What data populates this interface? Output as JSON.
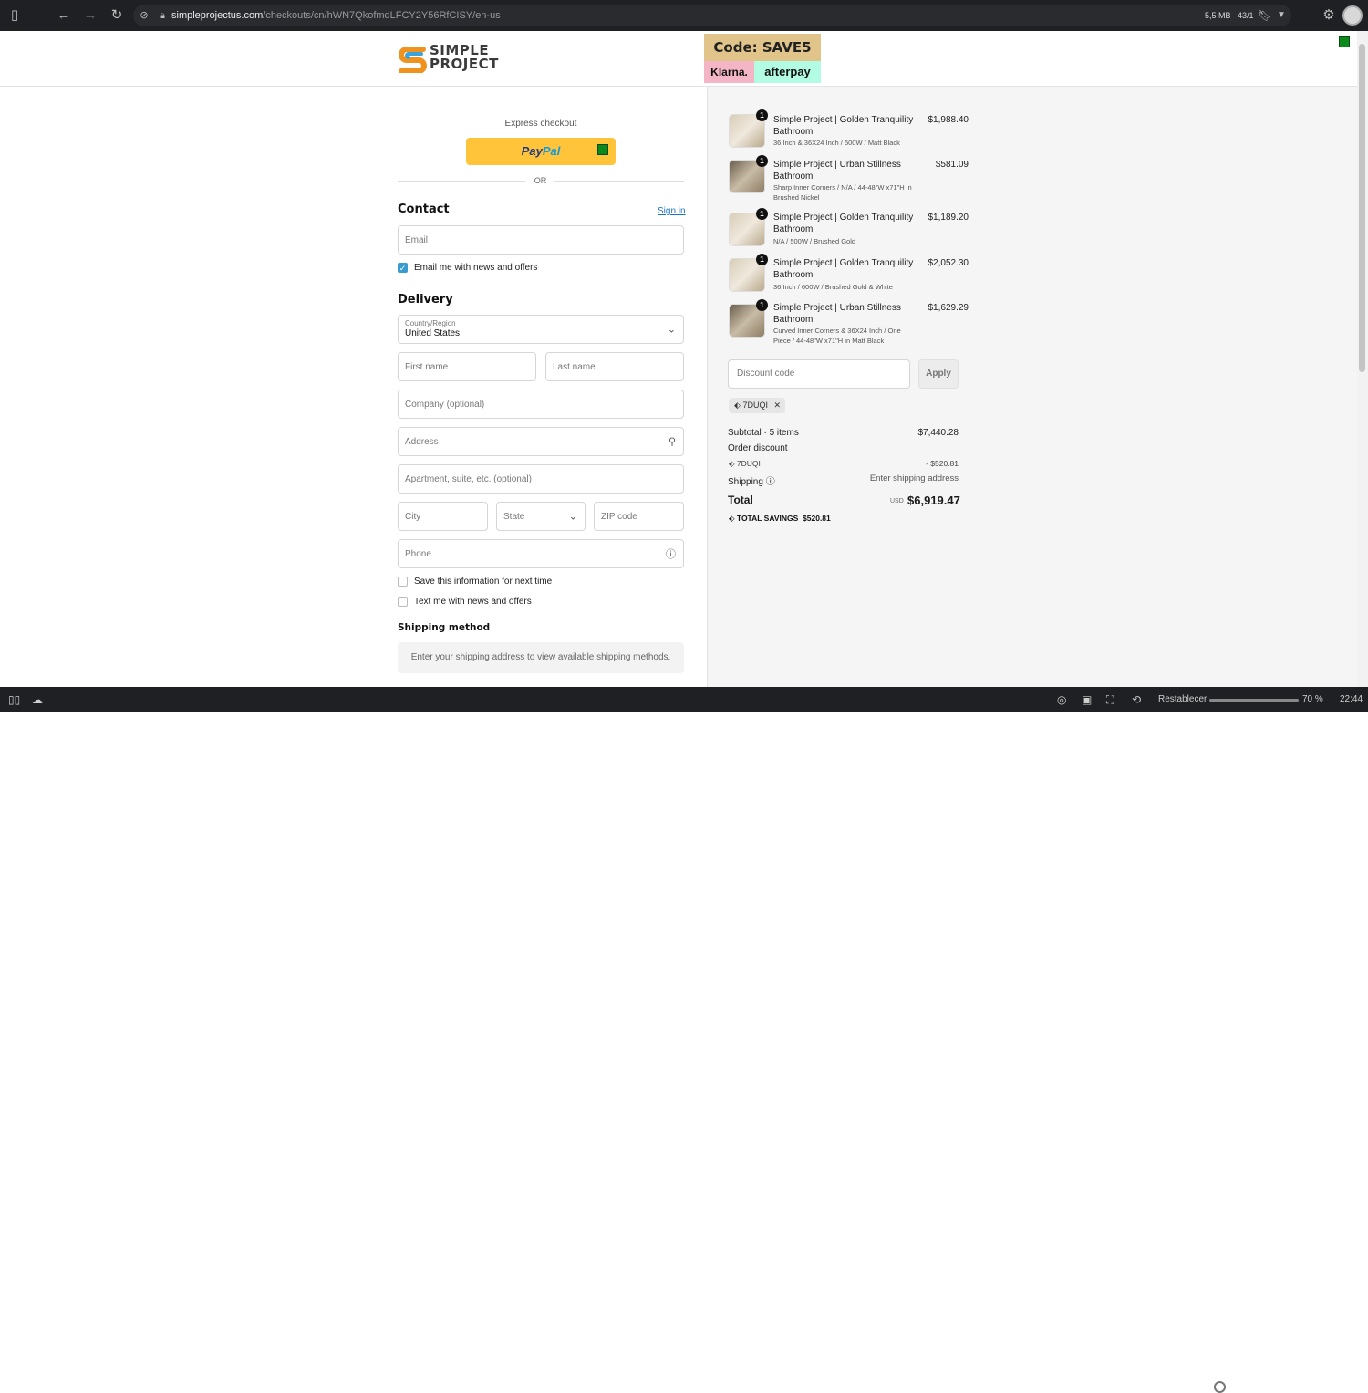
{
  "browser": {
    "url_domain": "simpleprojectus.com",
    "url_path": "/checkouts/cn/hWN7QkofmdLFCY2Y56RfCISY/en-us",
    "memory": "5,5 MB",
    "tab_count": "43/1"
  },
  "statusbar": {
    "reset_label": "Restablecer",
    "zoom": "70 %",
    "time": "22:44"
  },
  "header": {
    "logo_line1": "SIMPLE",
    "logo_line2": "PROJECT",
    "banner_code": "Code: SAVE5",
    "banner_klarna": "Klarna.",
    "banner_afterpay": "afterpay"
  },
  "checkout": {
    "express_label": "Express checkout",
    "paypal_pay": "Pay",
    "paypal_pal": "Pal",
    "or_label": "OR",
    "contact": {
      "title": "Contact",
      "sign_in": "Sign in",
      "email_placeholder": "Email",
      "news_label": "Email me with news and offers"
    },
    "delivery": {
      "title": "Delivery",
      "country_label": "Country/Region",
      "country_value": "United States",
      "first_name": "First name",
      "last_name": "Last name",
      "company": "Company (optional)",
      "address": "Address",
      "apartment": "Apartment, suite, etc. (optional)",
      "city": "City",
      "state": "State",
      "zip": "ZIP code",
      "phone": "Phone",
      "save_info": "Save this information for next time",
      "text_me": "Text me with news and offers"
    },
    "shipping": {
      "title": "Shipping method",
      "note": "Enter your shipping address to view available shipping methods."
    }
  },
  "order": {
    "items": [
      {
        "qty": "1",
        "name": "Simple Project | Golden Tranquility Bathroom",
        "variant": "36 Inch & 36X24 Inch / 500W / Matt Black",
        "price": "$1,988.40"
      },
      {
        "qty": "1",
        "name": "Simple Project | Urban Stillness Bathroom",
        "variant": "Sharp Inner Corners / N/A / 44-48\"W x71\"H in Brushed Nickel",
        "price": "$581.09"
      },
      {
        "qty": "1",
        "name": "Simple Project | Golden Tranquility Bathroom",
        "variant": "N/A / 500W / Brushed Gold",
        "price": "$1,189.20"
      },
      {
        "qty": "1",
        "name": "Simple Project | Golden Tranquility Bathroom",
        "variant": "36 Inch / 600W / Brushed Gold & White",
        "price": "$2,052.30"
      },
      {
        "qty": "1",
        "name": "Simple Project | Urban Stillness Bathroom",
        "variant": "Curved Inner Corners & 36X24 Inch / One Piece / 44-48\"W x71\"H in Matt Black",
        "price": "$1,629.29"
      }
    ],
    "discount_placeholder": "Discount code",
    "apply_label": "Apply",
    "applied_code": "7DUQI",
    "subtotal_label": "Subtotal · 5 items",
    "subtotal_value": "$7,440.28",
    "order_discount_label": "Order discount",
    "discount_code": "7DUQI",
    "discount_value": "- $520.81",
    "shipping_label": "Shipping",
    "shipping_value": "Enter shipping address",
    "total_label": "Total",
    "currency": "USD",
    "total_value": "$6,919.47",
    "savings_label": "TOTAL SAVINGS",
    "savings_value": "$520.81"
  },
  "colors": {
    "paypal_yellow": "#ffc439",
    "checkbox_blue": "#3a9bd1",
    "link_blue": "#1a73c9",
    "green_square": "#0b8a1b"
  }
}
